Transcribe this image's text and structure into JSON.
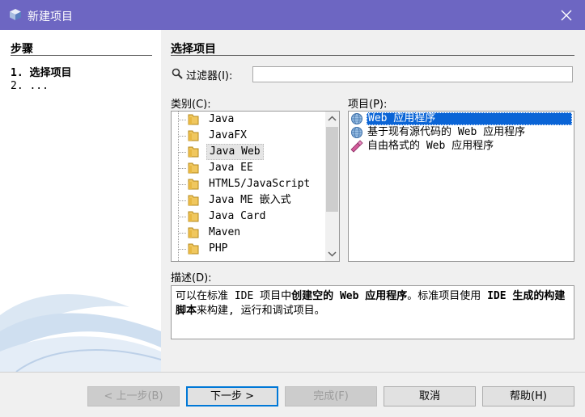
{
  "window": {
    "title": "新建项目"
  },
  "steps": {
    "title": "步骤",
    "items": [
      {
        "num": "1.",
        "label": "选择项目"
      },
      {
        "num": "2.",
        "label": "..."
      }
    ]
  },
  "main": {
    "title": "选择项目",
    "filter": {
      "label": "过滤器(I):",
      "value": ""
    },
    "categories": {
      "label": "类别(C):",
      "items": [
        "Java",
        "JavaFX",
        "Java Web",
        "Java EE",
        "HTML5/JavaScript",
        "Java ME 嵌入式",
        "Java Card",
        "Maven",
        "PHP"
      ],
      "selected_index": 2
    },
    "projects": {
      "label": "项目(P):",
      "items": [
        {
          "label": "Web 应用程序",
          "icon": "globe-icon"
        },
        {
          "label": "基于现有源代码的 Web 应用程序",
          "icon": "globe-icon"
        },
        {
          "label": "自由格式的 Web 应用程序",
          "icon": "freeform-icon"
        }
      ],
      "selected_index": 0
    },
    "description": {
      "label": "描述(D):",
      "p1": "可以在标准 IDE 项目中",
      "b1": "创建空的 Web 应用程序",
      "p2": "。标准项目使用 ",
      "b2": "IDE 生成的构建脚本",
      "p3": "来构建, 运行和调试项目。"
    }
  },
  "buttons": {
    "back": "< 上一步(B)",
    "next": "下一步 >",
    "finish": "完成(F)",
    "cancel": "取消",
    "help": "帮助(H)"
  },
  "colors": {
    "titlebar": "#6d66c2",
    "selection": "#0a64d6"
  }
}
